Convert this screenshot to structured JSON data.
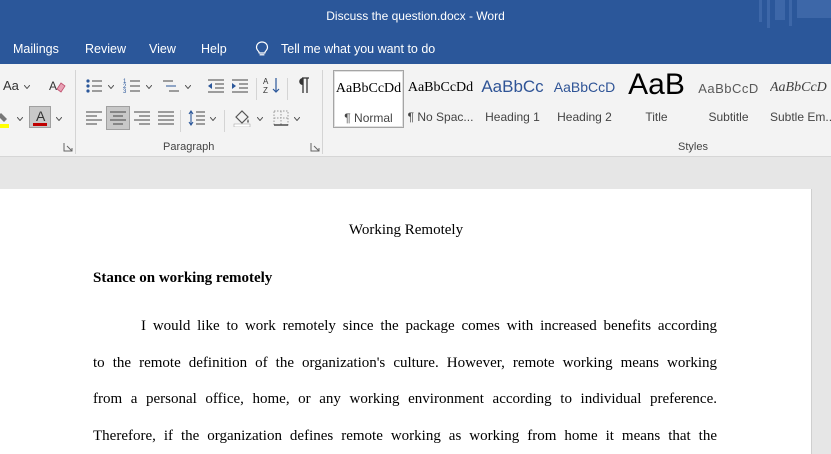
{
  "window": {
    "title": "Discuss the question.docx  -  Word"
  },
  "menu": {
    "items": [
      "Mailings",
      "Review",
      "View",
      "Help"
    ],
    "tell_me": "Tell me what you want to do"
  },
  "ribbon": {
    "font": {
      "change_case": "Aa",
      "font_color_letter": "A"
    },
    "paragraph": {
      "label": "Paragraph"
    },
    "styles": {
      "label": "Styles",
      "gallery": [
        {
          "sample": "AaBbCcDd",
          "name": "¶ Normal",
          "color": "#000000"
        },
        {
          "sample": "AaBbCcDd",
          "name": "¶ No Spac...",
          "color": "#000000"
        },
        {
          "sample": "AaBbCc",
          "name": "Heading 1",
          "color": "#2f5496"
        },
        {
          "sample": "AaBbCcD",
          "name": "Heading 2",
          "color": "#2f5496"
        },
        {
          "sample": "AaB",
          "name": "Title",
          "color": "#000000"
        },
        {
          "sample": "AaBbCcD",
          "name": "Subtitle",
          "color": "#595959"
        },
        {
          "sample": "AaBbCcD",
          "name": "Subtle Em...",
          "color": "#404040"
        }
      ]
    }
  },
  "document": {
    "title": "Working Remotely",
    "heading": "Stance on working remotely",
    "paragraph_lines": [
      "I would like to work remotely since the package comes with increased benefits according",
      "to the remote definition of the organization's culture. However, remote working means working",
      "from a personal office, home, or any working environment according to individual preference.",
      "Therefore, if the organization defines remote working as working from home it means that the"
    ]
  },
  "colors": {
    "word_blue": "#2b579a",
    "ribbon_bg": "#f3f3f3",
    "canvas_bg": "#e6e6e6",
    "font_color_underline": "#c00000",
    "highlight_yellow": "#ffff00"
  }
}
